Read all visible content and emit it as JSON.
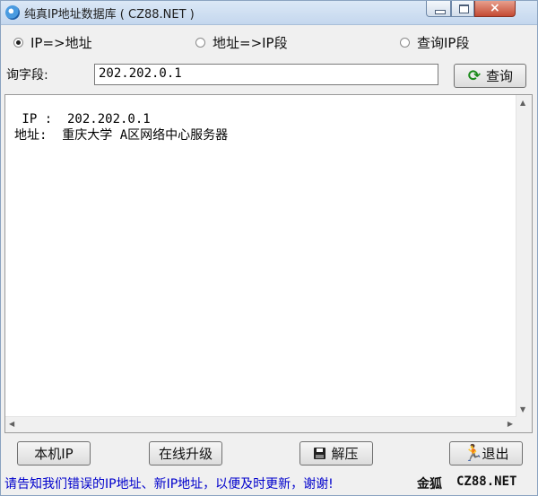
{
  "window": {
    "title": "纯真IP地址数据库  ( CZ88.NET )",
    "close_glyph": "×"
  },
  "modes": [
    {
      "label": "IP=>地址",
      "selected": true
    },
    {
      "label": "地址=>IP段",
      "selected": false
    },
    {
      "label": "查询IP段",
      "selected": false
    }
  ],
  "query": {
    "label": "询字段:",
    "value": "202.202.0.1",
    "button_label": "查询"
  },
  "result": {
    "line1": " IP :  202.202.0.1",
    "line2": "地址:  重庆大学 A区网络中心服务器"
  },
  "buttons": {
    "local_ip": "本机IP",
    "online_upgrade": "在线升级",
    "decompress": "解压",
    "exit": "退出"
  },
  "status": {
    "message": "请告知我们错误的IP地址、新IP地址，以便及时更新，谢谢!",
    "author": "金狐",
    "site": "CZ88.NET"
  },
  "colors": {
    "status_message": "#0000cc",
    "refresh_icon": "#1a8a1a",
    "close_button": "#c44a33"
  }
}
